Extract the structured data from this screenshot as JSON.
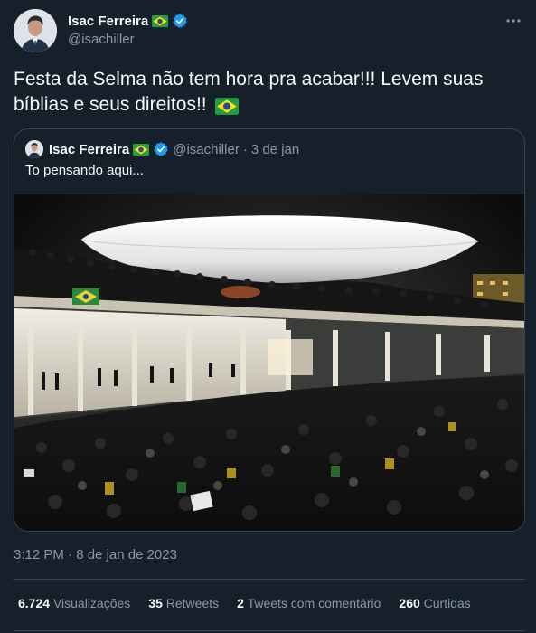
{
  "author": {
    "name": "Isac Ferreira",
    "handle": "@isachiller"
  },
  "tweet": {
    "text": "Festa da Selma não tem hora pra acabar!!! Levem suas bíblias e seus direitos!!",
    "timestamp": "3:12 PM · 8 de jan de 2023"
  },
  "quoted": {
    "name": "Isac Ferreira",
    "handle": "@isachiller",
    "separator": "·",
    "date": "3 de jan",
    "text": "To pensando aqui..."
  },
  "stats": [
    {
      "value": "6.724",
      "label": "Visualizações"
    },
    {
      "value": "35",
      "label": "Retweets"
    },
    {
      "value": "2",
      "label": "Tweets com comentário"
    },
    {
      "value": "260",
      "label": "Curtidas"
    }
  ],
  "icons": {
    "more": "more-icon",
    "verified": "verified-badge-icon",
    "flag": "brazil-flag-icon"
  },
  "colors": {
    "background": "#15202b",
    "text": "#f7f9f9",
    "secondary": "#8b98a5",
    "border": "#38444d",
    "verified": "#1d9bf0"
  }
}
